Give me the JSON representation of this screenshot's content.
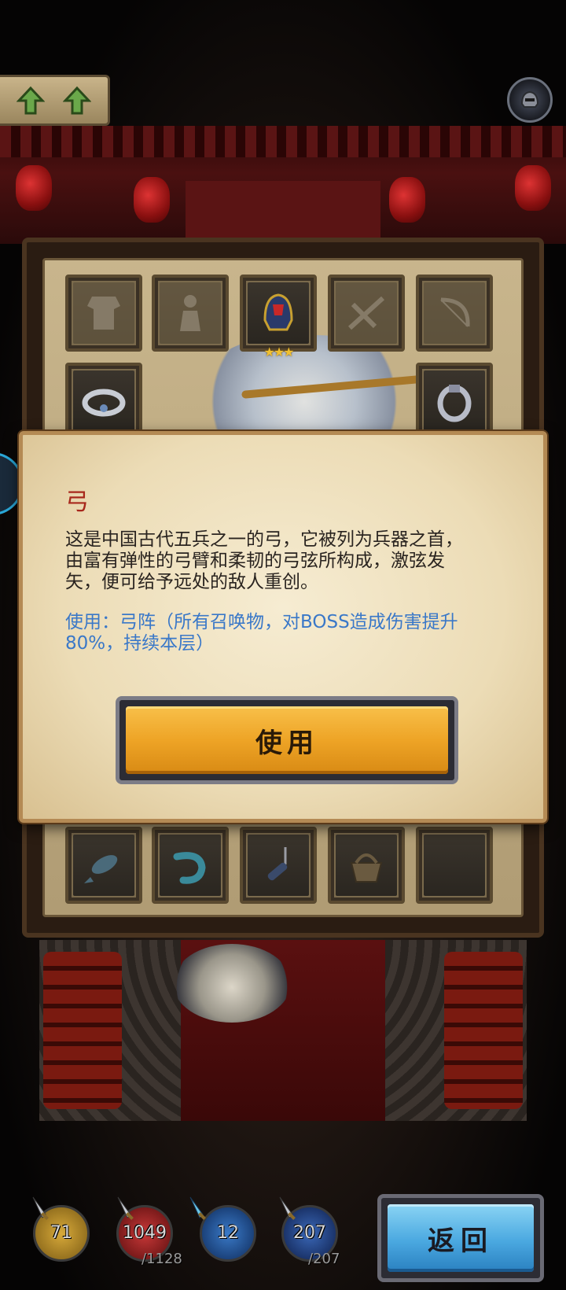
{
  "inventory": {
    "slots": [
      {
        "icon": "armor-icon",
        "stars": ""
      },
      {
        "icon": "warrior-figure-icon",
        "stars": ""
      },
      {
        "icon": "helmet-icon",
        "stars": "★★★"
      },
      {
        "icon": "crossbow-icon",
        "stars": ""
      },
      {
        "icon": "bow-icon",
        "stars": ""
      },
      {
        "icon": "bracelet-icon",
        "stars": "★"
      },
      {
        "icon": "ring-icon",
        "stars": "★★"
      },
      {
        "icon": "fish-icon",
        "stars": ""
      },
      {
        "icon": "shrimp-icon",
        "stars": ""
      },
      {
        "icon": "fishing-lure-icon",
        "stars": ""
      },
      {
        "icon": "basket-icon",
        "stars": ""
      },
      {
        "icon": "empty-slot",
        "stars": ""
      }
    ]
  },
  "dialog": {
    "title": "弓",
    "description": "这是中国古代五兵之一的弓，它被列为兵器之首，由富有弹性的弓臂和柔韧的弓弦所构成，激弦发矢，便可给予远处的敌人重创。",
    "usage": "使用：弓阵（所有召唤物，对BOSS造成伤害提升80%，持续本层）",
    "use_button": "使用"
  },
  "stats": {
    "level": {
      "value": "71",
      "icon": "sword-icon",
      "color": "#c89a2a"
    },
    "hp": {
      "value": "1049",
      "max": "/1128",
      "icon": "sword-icon",
      "color": "#b02828"
    },
    "mana_potion": {
      "value": "12",
      "icon": "dagger-icon",
      "color": "#2a6ab0"
    },
    "mp": {
      "value": "207",
      "max": "/207",
      "icon": "sword-icon",
      "color": "#2a58a8"
    }
  },
  "back_button": "返回",
  "colors": {
    "title_red": "#a8281c",
    "usage_blue": "#3a78c8",
    "use_button_gold": "#eea426",
    "back_button_blue": "#4aa8e0"
  }
}
